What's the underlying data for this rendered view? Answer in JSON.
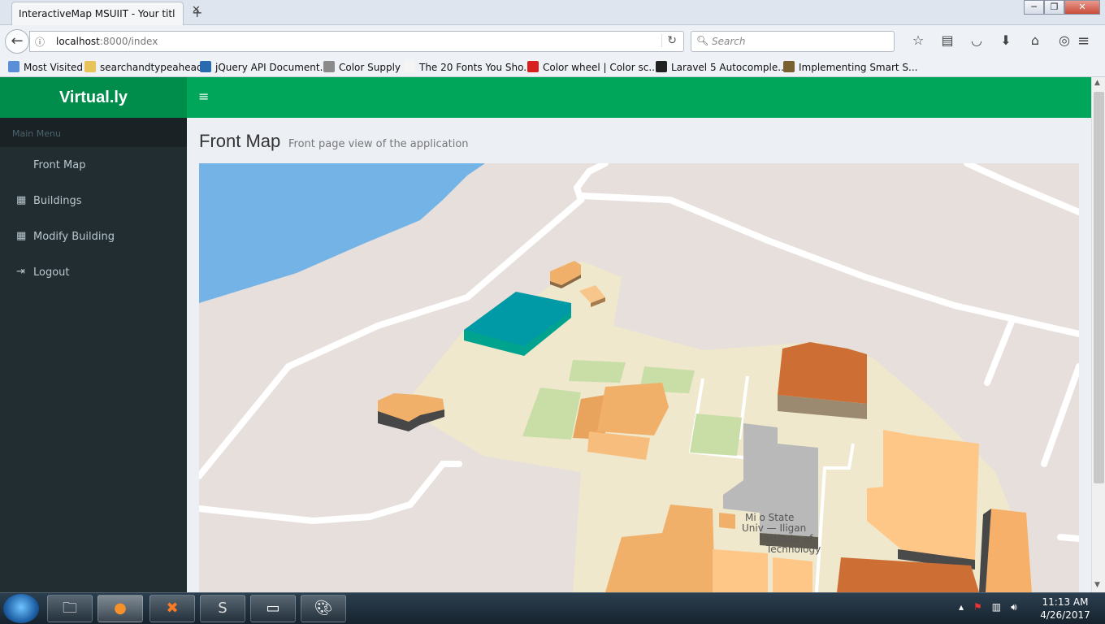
{
  "browser": {
    "tab_title": "InteractiveMap MSUIIT - Your titl",
    "url_host": "localhost",
    "url_rest": ":8000/index",
    "search_placeholder": "Search",
    "window_min": "─",
    "window_restore": "❐",
    "window_close": "✕",
    "bookmarks": [
      {
        "label": "Most Visited",
        "icon": "most-visited-icon",
        "color": "#5a8fd8"
      },
      {
        "label": "searchandtypeahead",
        "icon": "folder-icon",
        "color": "#e8c35a"
      },
      {
        "label": "jQuery API Document...",
        "icon": "jquery-icon",
        "color": "#2a6bb0"
      },
      {
        "label": "Color Supply",
        "icon": "globe-icon",
        "color": "#8a8a8a"
      },
      {
        "label": "The 20 Fonts You Sho...",
        "icon": "page-icon",
        "color": "#f4f4f4"
      },
      {
        "label": "Color wheel | Color sc...",
        "icon": "adobe-icon",
        "color": "#d8211f"
      },
      {
        "label": "Laravel 5 Autocomple...",
        "icon": "site-icon",
        "color": "#222222"
      },
      {
        "label": "Implementing Smart S...",
        "icon": "person-icon",
        "color": "#7a6030"
      }
    ]
  },
  "app": {
    "brand": "Virtual.ly",
    "menu_header": "Main Menu",
    "menu": [
      {
        "label": "Front Map",
        "icon": ""
      },
      {
        "label": "Buildings",
        "icon": "▦"
      },
      {
        "label": "Modify Building",
        "icon": "▦"
      },
      {
        "label": "Logout",
        "icon": "⇥"
      }
    ],
    "toggle_icon": "≡",
    "page_title": "Front Map",
    "page_subtitle": "Front page view of the application",
    "map_label_lines": [
      "Mi    o State",
      "Univ    — Iligan",
      "Institute of",
      "Technology"
    ]
  },
  "taskbar": {
    "time": "11:13 AM",
    "date": "4/26/2017"
  },
  "colors": {
    "brand_green": "#008d4c",
    "topbar_green": "#00a65a",
    "sidebar": "#222d32",
    "water": "#74b3e6",
    "highlight_building": "#009aa6"
  }
}
